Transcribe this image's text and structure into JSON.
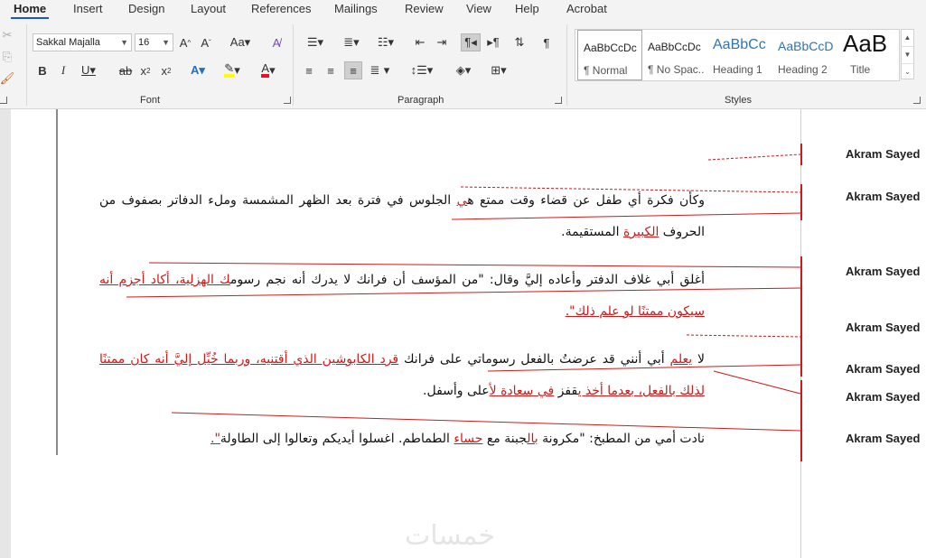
{
  "tabs": [
    "Home",
    "Insert",
    "Design",
    "Layout",
    "References",
    "Mailings",
    "Review",
    "View",
    "Help",
    "Acrobat"
  ],
  "ribbon": {
    "groups": {
      "font": "Font",
      "paragraph": "Paragraph",
      "styles": "Styles"
    },
    "font_name": "Sakkal Majalla",
    "font_size": "16",
    "style_gallery": [
      {
        "preview": "AaBbCcDc",
        "name": "¶ Normal"
      },
      {
        "preview": "AaBbCcDc",
        "name": "¶ No Spac..."
      },
      {
        "preview": "AaBbCc",
        "name": "Heading 1"
      },
      {
        "preview": "AaBbCcD",
        "name": "Heading 2"
      },
      {
        "preview": "AaB",
        "name": "Title"
      }
    ]
  },
  "comments": [
    "Akram Sayed",
    "Akram Sayed",
    "Akram Sayed",
    "Akram Sayed",
    "Akram Sayed",
    "Akram Sayed",
    "Akram Sayed"
  ],
  "document": {
    "p1": {
      "a": "وكأن فكرة أي طفل عن قضاء وقت ممتع ه",
      "b": "ي",
      "c": " الجلوس في فترة بعد الظهر المشمسة وملء الدفاتر بصفوف من الحروف ",
      "d": "الكبيرة",
      "e": " المستقيمة."
    },
    "p2": {
      "a": "أغلق أبي غلاف الدفتر وأعاده إليَّ وقال: \"من المؤسف أن فرانك لا يدرك أنه نجم رسوم",
      "b": "ك الهزلية، أكاد أجزم أنه سيكون ممتنًا لو علم ذلك\"."
    },
    "p3": {
      "a": "لا ",
      "b": "يعلم",
      "c": " أبي أنني قد عرضتُ بالفعل رسوماتي على فرانك ",
      "d": "قرد الكابوشين الذي أقتنيه، وربما خُيِّل إليَّ أنه كان ممتنًا لذلك بالفعل، بعدما أخذ ي",
      "e": "قفز ",
      "f": "في سعادة لأ",
      "g": "على وأسفل."
    },
    "p4": {
      "a": "نادت أمي من المطبخ: \"مكرونة ",
      "b": "بال",
      "c": "جبنة مع ",
      "d": "حساء",
      "e": " الطماطم. اغسلوا أيديكم وتعالوا إلى الطاولة",
      "f": "\"."
    }
  },
  "watermark": "خمسات",
  "colors": {
    "ribbon_bg": "#f3f3f3",
    "tab_accent": "#185abd",
    "revision_red": "#d01818",
    "highlight_yellow": "#ffff00",
    "font_color_red": "#e81123"
  }
}
